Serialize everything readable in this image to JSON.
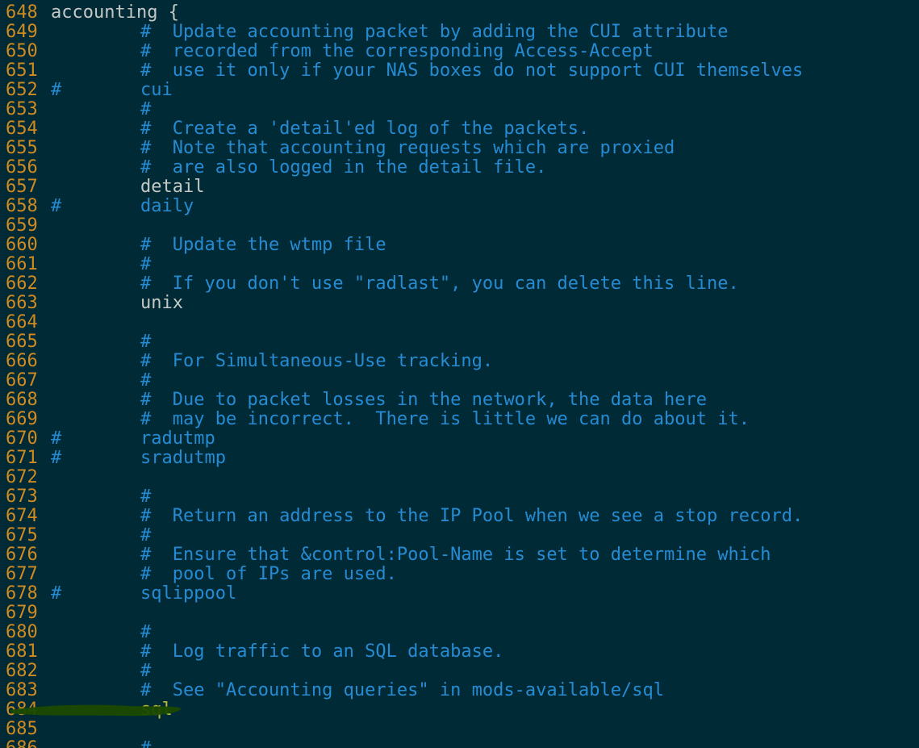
{
  "editor": {
    "lines": [
      {
        "num": "648",
        "hash": "",
        "text": "accounting {",
        "kind": "plain",
        "top": true
      },
      {
        "num": "649",
        "hash": "",
        "text": "#  Update accounting packet by adding the CUI attribute",
        "kind": "comment"
      },
      {
        "num": "650",
        "hash": "",
        "text": "#  recorded from the corresponding Access-Accept",
        "kind": "comment"
      },
      {
        "num": "651",
        "hash": "",
        "text": "#  use it only if your NAS boxes do not support CUI themselves",
        "kind": "comment"
      },
      {
        "num": "652",
        "hash": "#",
        "text": "cui",
        "kind": "commented"
      },
      {
        "num": "653",
        "hash": "",
        "text": "#",
        "kind": "comment"
      },
      {
        "num": "654",
        "hash": "",
        "text": "#  Create a 'detail'ed log of the packets.",
        "kind": "comment"
      },
      {
        "num": "655",
        "hash": "",
        "text": "#  Note that accounting requests which are proxied",
        "kind": "comment"
      },
      {
        "num": "656",
        "hash": "",
        "text": "#  are also logged in the detail file.",
        "kind": "comment"
      },
      {
        "num": "657",
        "hash": "",
        "text": "detail",
        "kind": "code"
      },
      {
        "num": "658",
        "hash": "#",
        "text": "daily",
        "kind": "commented"
      },
      {
        "num": "659",
        "hash": "",
        "text": "",
        "kind": "code"
      },
      {
        "num": "660",
        "hash": "",
        "text": "#  Update the wtmp file",
        "kind": "comment"
      },
      {
        "num": "661",
        "hash": "",
        "text": "#",
        "kind": "comment"
      },
      {
        "num": "662",
        "hash": "",
        "text": "#  If you don't use \"radlast\", you can delete this line.",
        "kind": "comment"
      },
      {
        "num": "663",
        "hash": "",
        "text": "unix",
        "kind": "code"
      },
      {
        "num": "664",
        "hash": "",
        "text": "",
        "kind": "code"
      },
      {
        "num": "665",
        "hash": "",
        "text": "#",
        "kind": "comment"
      },
      {
        "num": "666",
        "hash": "",
        "text": "#  For Simultaneous-Use tracking.",
        "kind": "comment"
      },
      {
        "num": "667",
        "hash": "",
        "text": "#",
        "kind": "comment"
      },
      {
        "num": "668",
        "hash": "",
        "text": "#  Due to packet losses in the network, the data here",
        "kind": "comment"
      },
      {
        "num": "669",
        "hash": "",
        "text": "#  may be incorrect.  There is little we can do about it.",
        "kind": "comment"
      },
      {
        "num": "670",
        "hash": "#",
        "text": "radutmp",
        "kind": "commented"
      },
      {
        "num": "671",
        "hash": "#",
        "text": "sradutmp",
        "kind": "commented"
      },
      {
        "num": "672",
        "hash": "",
        "text": "",
        "kind": "code"
      },
      {
        "num": "673",
        "hash": "",
        "text": "#",
        "kind": "comment"
      },
      {
        "num": "674",
        "hash": "",
        "text": "#  Return an address to the IP Pool when we see a stop record.",
        "kind": "comment"
      },
      {
        "num": "675",
        "hash": "",
        "text": "#",
        "kind": "comment"
      },
      {
        "num": "676",
        "hash": "",
        "text": "#  Ensure that &control:Pool-Name is set to determine which",
        "kind": "comment"
      },
      {
        "num": "677",
        "hash": "",
        "text": "#  pool of IPs are used.",
        "kind": "comment"
      },
      {
        "num": "678",
        "hash": "#",
        "text": "sqlippool",
        "kind": "commented"
      },
      {
        "num": "679",
        "hash": "",
        "text": "",
        "kind": "code"
      },
      {
        "num": "680",
        "hash": "",
        "text": "#",
        "kind": "comment"
      },
      {
        "num": "681",
        "hash": "",
        "text": "#  Log traffic to an SQL database.",
        "kind": "comment"
      },
      {
        "num": "682",
        "hash": "",
        "text": "#",
        "kind": "comment"
      },
      {
        "num": "683",
        "hash": "",
        "text": "#  See \"Accounting queries\" in mods-available/sql",
        "kind": "comment"
      },
      {
        "num": "684",
        "hash": "",
        "text": "sql",
        "kind": "highlight"
      },
      {
        "num": "685",
        "hash": "",
        "text": "",
        "kind": "code"
      },
      {
        "num": "686",
        "hash": "",
        "text": "#",
        "kind": "comment"
      }
    ]
  },
  "colors": {
    "background": "#002b36",
    "line_number": "#d08a21",
    "comment": "#268bd2",
    "code": "#c4c9c6",
    "highlight_marker": "#1b4a00"
  }
}
